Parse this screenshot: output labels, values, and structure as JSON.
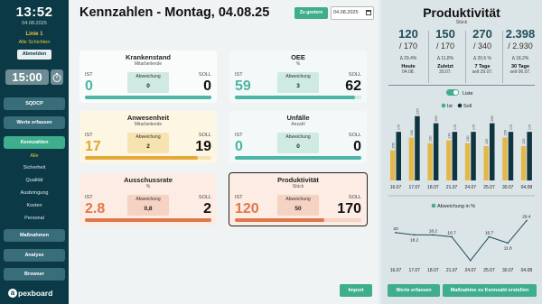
{
  "sidebar": {
    "time": "13:52",
    "date": "04.08.2025",
    "line": "Linie 1",
    "shift": "Alle Schichten",
    "logout": "Abmelden",
    "timer": "15:00",
    "buttons": {
      "sqdcp": "SQDCP",
      "enter_values": "Werte erfassen",
      "kpis": "Kennzahlen",
      "measures": "Maßnahmen",
      "analysis": "Analyse",
      "browser": "Browser"
    },
    "sub_items": [
      "Alle",
      "Sicherheit",
      "Qualität",
      "Ausbringung",
      "Kosten",
      "Personal"
    ],
    "logo_letter": "a",
    "logo_text": "pexboard"
  },
  "main": {
    "title": "Kennzahlen - Montag, 04.08.25",
    "prev_button": "Zu gestern",
    "date_value": "04.08.2025",
    "import_button": "Import",
    "ist_label": "IST",
    "soll_label": "SOLL",
    "deviation_label": "Abweichung",
    "cards": [
      {
        "title": "Krankenstand",
        "subtitle": "Mitarbeitende",
        "ist": "0",
        "soll": "0",
        "deviation": "0",
        "progress": 1.0
      },
      {
        "title": "OEE",
        "subtitle": "%",
        "ist": "59",
        "soll": "62",
        "deviation": "3",
        "progress": 0.95
      },
      {
        "title": "Anwesenheit",
        "subtitle": "Mitarbeitende",
        "ist": "17",
        "soll": "19",
        "deviation": "2",
        "progress": 0.89
      },
      {
        "title": "Unfälle",
        "subtitle": "Anzahl",
        "ist": "0",
        "soll": "0",
        "deviation": "0",
        "progress": 1.0
      },
      {
        "title": "Ausschussrate",
        "subtitle": "%",
        "ist": "2.8",
        "soll": "2",
        "deviation": "0,8",
        "progress": 1.0
      },
      {
        "title": "Produktivität",
        "subtitle": "Stück",
        "ist": "120",
        "soll": "170",
        "deviation": "50",
        "progress": 0.71
      }
    ]
  },
  "panel": {
    "title": "Produktivität",
    "unit": "Stück",
    "stats": [
      {
        "value": "120",
        "target": "/ 170",
        "delta": "Δ 29,4%",
        "label": "Heute",
        "date": "04.08."
      },
      {
        "value": "150",
        "target": "/ 170",
        "delta": "Δ 11,8%",
        "label": "Zuletzt",
        "date": "30.07."
      },
      {
        "value": "270",
        "target": "/ 340",
        "delta": "Δ 20,6 %",
        "label": "7 Tage",
        "date": "seit 29.07."
      },
      {
        "value": "2.398",
        "target": "/ 2.930",
        "delta": "Δ 18,2%",
        "label": "30 Tage",
        "date": "seit 06.07."
      }
    ],
    "toggle_label": "Liste",
    "legend_ist": "Ist",
    "legend_soll": "Soll",
    "legend_deviation": "Abweichung in %",
    "enter_values_button": "Werte erfassen",
    "measure_button": "Maßnahme zu Kennzahl erstellen"
  },
  "colors": {
    "sidebar": "#0b3a46",
    "accent": "#3fae8d",
    "gold": "#f0c23c",
    "ist_bar": "#e3b84a",
    "soll_bar": "#0f3640",
    "green": "#4cb5a5",
    "amber": "#e6a83a",
    "red": "#e0774a"
  },
  "chart_data": [
    {
      "type": "bar",
      "categories": [
        "16.07",
        "17.07",
        "18.07",
        "21.07",
        "24.07",
        "25.07",
        "30.07",
        "04.08"
      ],
      "series": [
        {
          "name": "Ist",
          "values": [
            105,
            150,
            130,
            140,
            130,
            120,
            150,
            120
          ]
        },
        {
          "name": "Soll",
          "values": [
            170,
            225,
            200,
            170,
            170,
            200,
            170,
            170
          ]
        }
      ]
    },
    {
      "type": "line",
      "categories": [
        "16.07",
        "17.07",
        "18.07",
        "21.07",
        "24.07",
        "25.07",
        "30.07",
        "04.08"
      ],
      "series": [
        {
          "name": "Abweichung in %",
          "values": [
            20,
            18.2,
            18.2,
            16.7,
            -2,
            16.7,
            11.8,
            29.4
          ]
        }
      ],
      "data_labels": [
        "20",
        "18.2",
        "18.2",
        "16.7",
        "",
        "16.7",
        "11.8",
        "29.4"
      ]
    }
  ]
}
